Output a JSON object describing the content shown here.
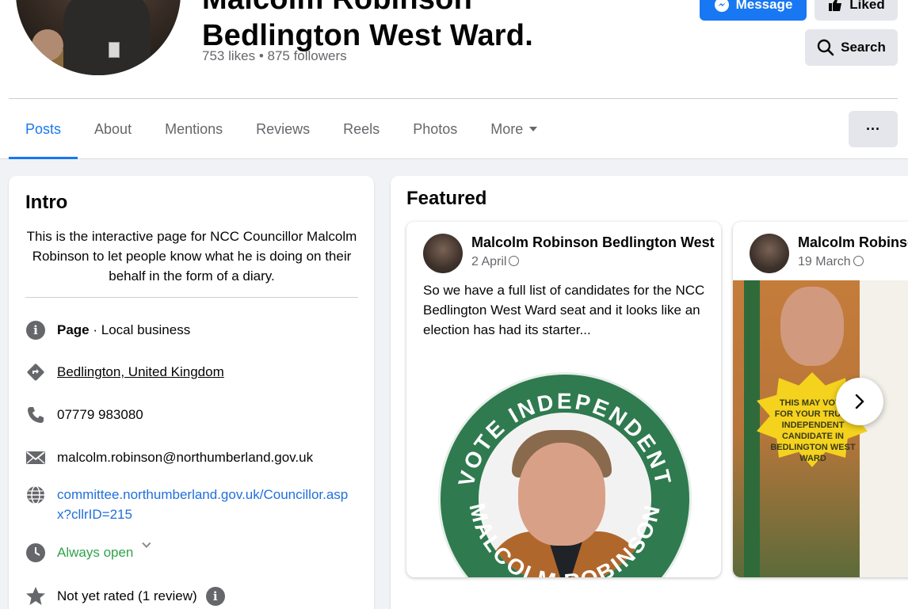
{
  "header": {
    "title_line1": "Malcolm Robinson",
    "title_line2": "Bedlington West Ward.",
    "stats": "753 likes • 875 followers",
    "message_label": "Message",
    "liked_label": "Liked",
    "search_label": "Search"
  },
  "tabs": [
    {
      "label": "Posts",
      "active": true
    },
    {
      "label": "About"
    },
    {
      "label": "Mentions"
    },
    {
      "label": "Reviews"
    },
    {
      "label": "Reels"
    },
    {
      "label": "Photos"
    },
    {
      "label": "More"
    }
  ],
  "more_menu_label": "···",
  "intro": {
    "title": "Intro",
    "bio": "This is the interactive page for NCC Councillor Malcolm Robinson to let people know what he is doing on their behalf in the form of a diary.",
    "page_label": "Page",
    "page_category": " · Local business",
    "location": "Bedlington, United Kingdom",
    "phone": "07779 983080",
    "email": "malcolm.robinson@northumberland.gov.uk",
    "website": "committee.northumberland.gov.uk/Councillor.aspx?cllrID=215",
    "hours": "Always open",
    "rating": "Not yet rated (1 review)"
  },
  "featured": {
    "title": "Featured",
    "posts": [
      {
        "author": "Malcolm Robinson Bedlington West",
        "date": "2 April",
        "text": "So we have a full list of candidates for the NCC Bedlington West Ward seat and it looks like an election has had its starter...",
        "image_text_top": "VOTE INDEPENDENT",
        "image_text_bottom": "MALCOLM ROBINSON"
      },
      {
        "author": "Malcolm Robinson",
        "date": "19 March",
        "image_text": "THIS MAY VOTE FOR YOUR TRULY INDEPENDENT CANDIDATE IN BEDLINGTON WEST WARD"
      }
    ]
  },
  "colors": {
    "accent": "#1877f2",
    "green": "#31a24c",
    "link": "#216fdb"
  }
}
